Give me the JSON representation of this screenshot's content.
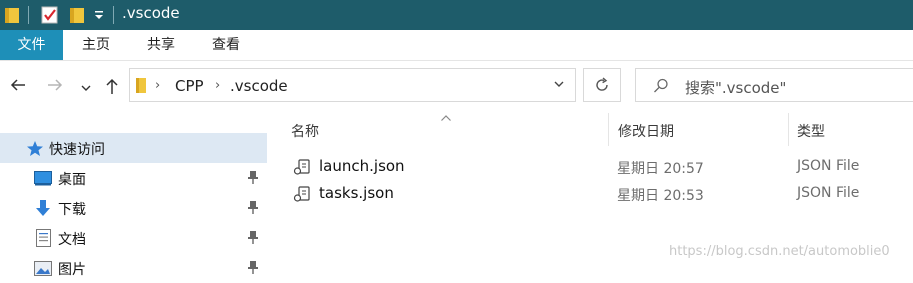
{
  "window": {
    "title": ".vscode"
  },
  "ribbon": {
    "tabs": [
      "文件",
      "主页",
      "共享",
      "查看"
    ]
  },
  "address": {
    "crumbs": [
      "CPP",
      ".vscode"
    ]
  },
  "search": {
    "placeholder": "搜索\".vscode\""
  },
  "nav": {
    "quick_access": "快速访问",
    "items": [
      {
        "label": "桌面",
        "icon": "desktop-icon",
        "pinned": true
      },
      {
        "label": "下载",
        "icon": "download-icon",
        "pinned": true
      },
      {
        "label": "文档",
        "icon": "documents-icon",
        "pinned": true
      },
      {
        "label": "图片",
        "icon": "pictures-icon",
        "pinned": true
      }
    ]
  },
  "columns": {
    "name": "名称",
    "modified": "修改日期",
    "type": "类型"
  },
  "files": [
    {
      "name": "launch.json",
      "modified": "星期日 20:57",
      "type": "JSON File",
      "icon": "vscode-json-icon"
    },
    {
      "name": "tasks.json",
      "modified": "星期日 20:53",
      "type": "JSON File",
      "icon": "vscode-json-icon"
    }
  ],
  "watermark": "https://blog.csdn.net/automoblie0",
  "colors": {
    "titlebar": "#1e5c6a",
    "file_tab": "#1e8fb8",
    "selection": "#dde8f3",
    "folder": "#f0c63d"
  }
}
